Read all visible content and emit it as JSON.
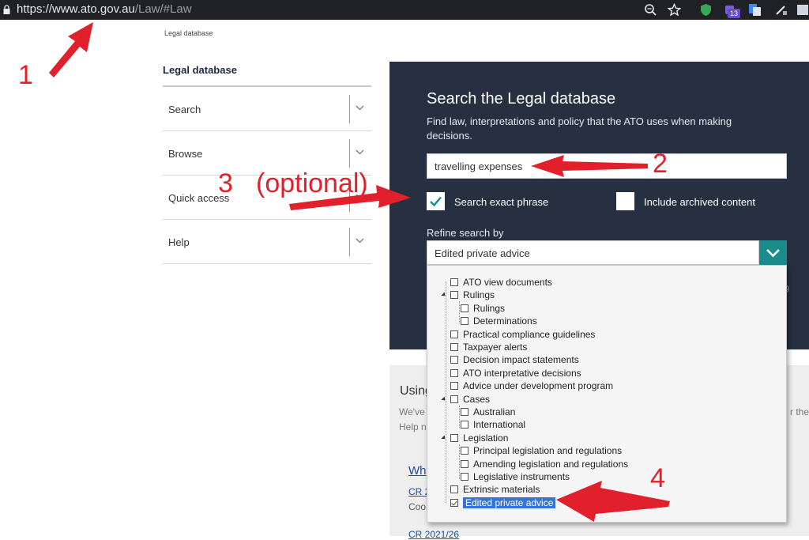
{
  "browser": {
    "url_host": "https://www.ato.gov.au",
    "url_path": "/Law/#Law",
    "extension_badge": "13"
  },
  "breadcrumb": "Legal database",
  "sidebar": {
    "title": "Legal database",
    "items": [
      {
        "label": "Search"
      },
      {
        "label": "Browse"
      },
      {
        "label": "Quick access"
      },
      {
        "label": "Help"
      }
    ]
  },
  "search_panel": {
    "title": "Search the Legal database",
    "description": "Find law, interpretations and policy that the ATO uses when making decisions.",
    "query": "travelling expenses",
    "exact_phrase_label": "Search exact phrase",
    "exact_phrase_checked": true,
    "archived_label": "Include archived content",
    "archived_checked": false,
    "refine_label": "Refine search by",
    "refine_value": "Edited private advice",
    "accent_color": "#1b8c8c"
  },
  "refine_options": [
    {
      "label": "ATO view documents",
      "level": 0,
      "expandable": false,
      "checked": false,
      "selected": false
    },
    {
      "label": "Rulings",
      "level": 0,
      "expandable": true,
      "checked": false,
      "selected": false
    },
    {
      "label": "Rulings",
      "level": 1,
      "expandable": false,
      "checked": false,
      "selected": false
    },
    {
      "label": "Determinations",
      "level": 1,
      "expandable": false,
      "checked": false,
      "selected": false
    },
    {
      "label": "Practical compliance guidelines",
      "level": 0,
      "expandable": false,
      "checked": false,
      "selected": false
    },
    {
      "label": "Taxpayer alerts",
      "level": 0,
      "expandable": false,
      "checked": false,
      "selected": false
    },
    {
      "label": "Decision impact statements",
      "level": 0,
      "expandable": false,
      "checked": false,
      "selected": false
    },
    {
      "label": "ATO interpretative decisions",
      "level": 0,
      "expandable": false,
      "checked": false,
      "selected": false
    },
    {
      "label": "Advice under development program",
      "level": 0,
      "expandable": false,
      "checked": false,
      "selected": false
    },
    {
      "label": "Cases",
      "level": 0,
      "expandable": true,
      "checked": false,
      "selected": false
    },
    {
      "label": "Australian",
      "level": 1,
      "expandable": false,
      "checked": false,
      "selected": false
    },
    {
      "label": "International",
      "level": 1,
      "expandable": false,
      "checked": false,
      "selected": false
    },
    {
      "label": "Legislation",
      "level": 0,
      "expandable": true,
      "checked": false,
      "selected": false
    },
    {
      "label": "Principal legislation and regulations",
      "level": 1,
      "expandable": false,
      "checked": false,
      "selected": false
    },
    {
      "label": "Amending legislation and regulations",
      "level": 1,
      "expandable": false,
      "checked": false,
      "selected": false
    },
    {
      "label": "Legislative instruments",
      "level": 1,
      "expandable": false,
      "checked": false,
      "selected": false
    },
    {
      "label": "Extrinsic materials",
      "level": 0,
      "expandable": false,
      "checked": false,
      "selected": false
    },
    {
      "label": "Edited private advice",
      "level": 0,
      "expandable": false,
      "checked": true,
      "selected": true
    }
  ],
  "lower_section": {
    "heading": "Using",
    "text1": "We've",
    "text2": "Help n",
    "text3": "r the",
    "link1": "Wh",
    "link2": "CR 2",
    "text4": "Coo",
    "link3": "CR 2021/26"
  },
  "annotations": {
    "step1": "1",
    "step2": "2",
    "step3": "3",
    "step3_note": "(optional)",
    "step4": "4",
    "color": "#e2202c"
  }
}
